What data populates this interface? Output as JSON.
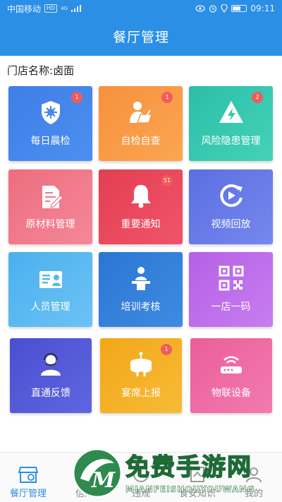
{
  "status_bar": {
    "carrier": "中国移动",
    "hd": "HD",
    "network": "4G",
    "time": "09:11"
  },
  "title": "餐厅管理",
  "store": {
    "label": "门店名称:",
    "name": "卤面"
  },
  "colors": {
    "primary": "#2b8fe6",
    "badge": "#f25b5b"
  },
  "tiles": [
    {
      "label": "每日晨检",
      "badge": "1",
      "icon": "virus-shield-icon"
    },
    {
      "label": "自检自查",
      "badge": "1",
      "icon": "person-writing-icon"
    },
    {
      "label": "风险隐患管理",
      "badge": "2",
      "icon": "warning-bolt-icon"
    },
    {
      "label": "原材料管理",
      "badge": "",
      "icon": "document-edit-icon"
    },
    {
      "label": "重要通知",
      "badge": "51",
      "icon": "bell-icon"
    },
    {
      "label": "视频回放",
      "badge": "",
      "icon": "video-replay-icon"
    },
    {
      "label": "人员管理",
      "badge": "",
      "icon": "id-card-icon"
    },
    {
      "label": "培训考核",
      "badge": "",
      "icon": "lecturer-icon"
    },
    {
      "label": "一店一码",
      "badge": "",
      "icon": "qr-code-icon"
    },
    {
      "label": "直通反馈",
      "badge": "",
      "icon": "support-agent-icon"
    },
    {
      "label": "宴席上报",
      "badge": "1",
      "icon": "banquet-table-icon"
    },
    {
      "label": "物联设备",
      "badge": "",
      "icon": "router-icon"
    }
  ],
  "tabs": [
    {
      "label": "餐厅管理",
      "active": true
    },
    {
      "label": "信用"
    },
    {
      "label": "违规"
    },
    {
      "label": "食安知识"
    },
    {
      "label": "我的"
    }
  ],
  "watermark": {
    "text": "免费手游网",
    "url": "MIANFEISHOUYOUWANG"
  }
}
